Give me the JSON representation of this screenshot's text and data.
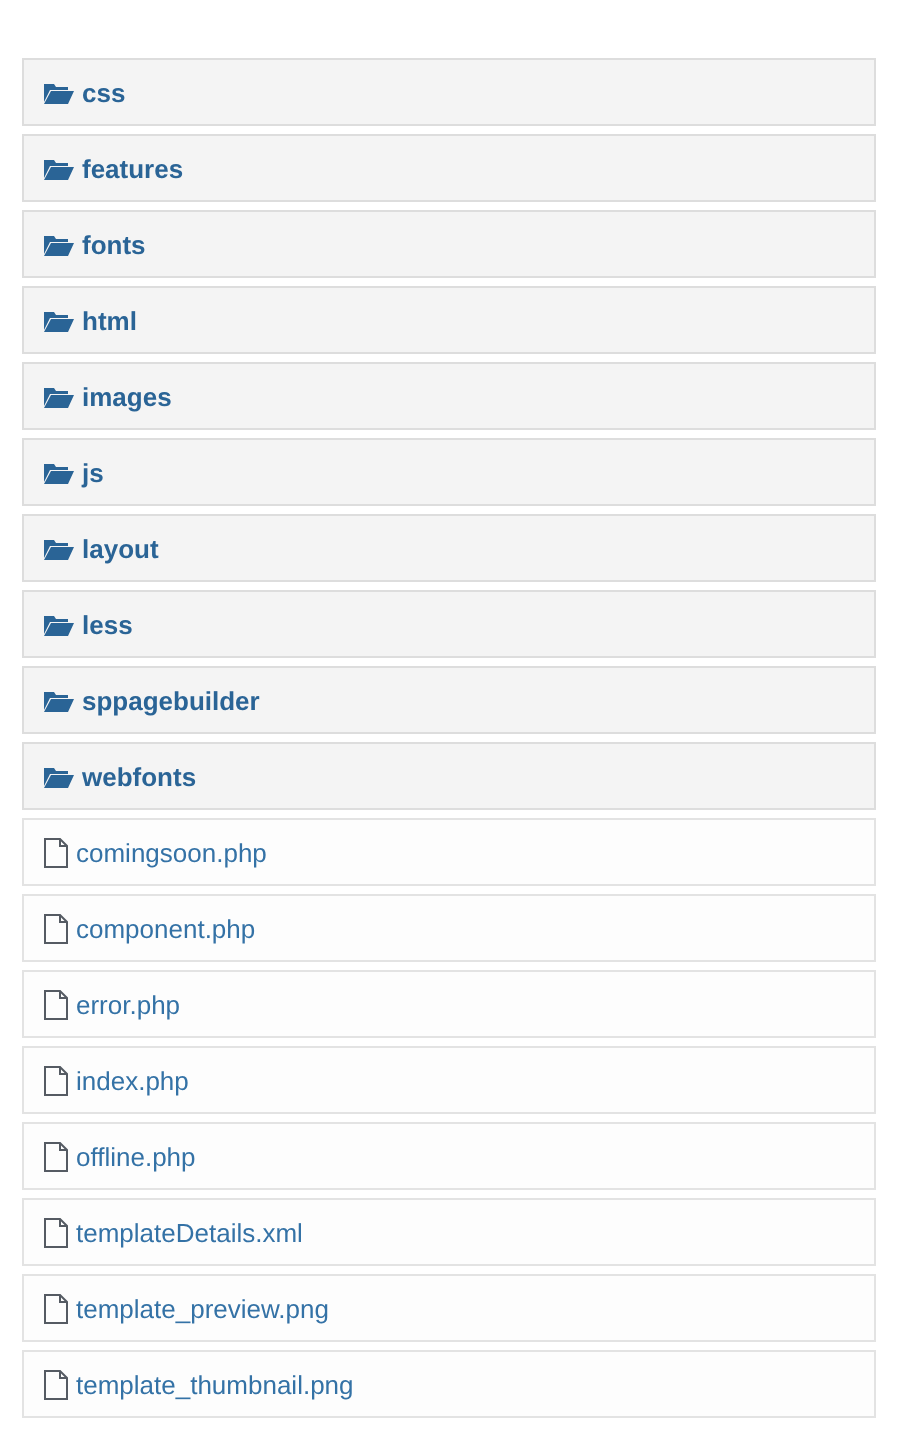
{
  "items": [
    {
      "kind": "folder",
      "name": "css"
    },
    {
      "kind": "folder",
      "name": "features"
    },
    {
      "kind": "folder",
      "name": "fonts"
    },
    {
      "kind": "folder",
      "name": "html"
    },
    {
      "kind": "folder",
      "name": "images"
    },
    {
      "kind": "folder",
      "name": "js"
    },
    {
      "kind": "folder",
      "name": "layout"
    },
    {
      "kind": "folder",
      "name": "less"
    },
    {
      "kind": "folder",
      "name": "sppagebuilder"
    },
    {
      "kind": "folder",
      "name": "webfonts"
    },
    {
      "kind": "file",
      "name": "comingsoon.php"
    },
    {
      "kind": "file",
      "name": "component.php"
    },
    {
      "kind": "file",
      "name": "error.php"
    },
    {
      "kind": "file",
      "name": "index.php"
    },
    {
      "kind": "file",
      "name": "offline.php"
    },
    {
      "kind": "file",
      "name": "templateDetails.xml"
    },
    {
      "kind": "file",
      "name": "template_preview.png"
    },
    {
      "kind": "file",
      "name": "template_thumbnail.png"
    }
  ]
}
